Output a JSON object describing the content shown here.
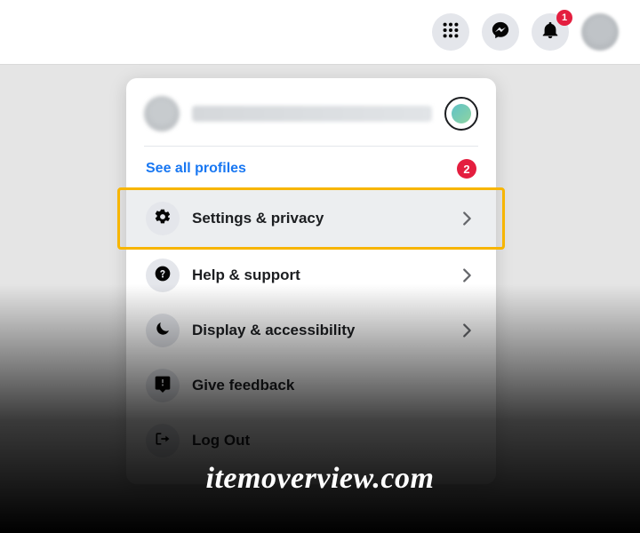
{
  "topbar": {
    "notification_badge": "1"
  },
  "menu": {
    "see_all_label": "See all profiles",
    "see_all_count": "2",
    "items": [
      {
        "label": "Settings & privacy",
        "icon": "gear",
        "chevron": true,
        "highlight": true
      },
      {
        "label": "Help & support",
        "icon": "question",
        "chevron": true,
        "highlight": false
      },
      {
        "label": "Display & accessibility",
        "icon": "moon",
        "chevron": true,
        "highlight": false
      },
      {
        "label": "Give feedback",
        "icon": "feedback",
        "chevron": false,
        "highlight": false
      },
      {
        "label": "Log Out",
        "icon": "logout",
        "chevron": false,
        "highlight": false
      }
    ]
  },
  "watermark": "itemoverview.com"
}
